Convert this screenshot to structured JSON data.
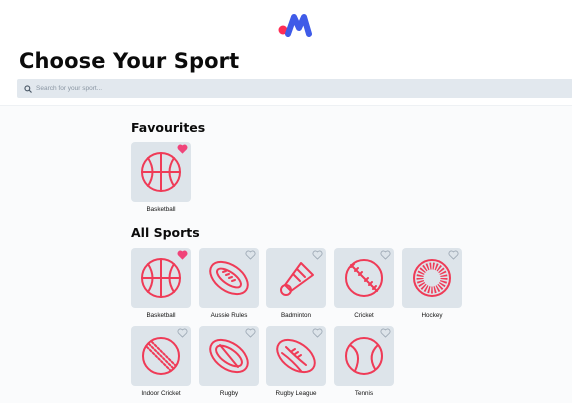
{
  "header": {
    "title": "Choose Your Sport",
    "brand_colors": {
      "dot": "#ff2d55",
      "mark": "#3f5be8"
    }
  },
  "search": {
    "placeholder": "Search for your sport..."
  },
  "sections": {
    "favourites_title": "Favourites",
    "all_title": "All Sports"
  },
  "favourites": [
    {
      "label": "Basketball",
      "icon": "basketball-icon",
      "favourited": true
    }
  ],
  "sports": [
    {
      "label": "Basketball",
      "icon": "basketball-icon",
      "favourited": true
    },
    {
      "label": "Aussie Rules",
      "icon": "aussie-rules-ball-icon",
      "favourited": false
    },
    {
      "label": "Badminton",
      "icon": "shuttlecock-icon",
      "favourited": false
    },
    {
      "label": "Cricket",
      "icon": "cricket-ball-icon",
      "favourited": false
    },
    {
      "label": "Hockey",
      "icon": "hockey-ball-icon",
      "favourited": false
    },
    {
      "label": "Indoor Cricket",
      "icon": "indoor-cricket-ball-icon",
      "favourited": false
    },
    {
      "label": "Rugby",
      "icon": "rugby-ball-icon",
      "favourited": false
    },
    {
      "label": "Rugby League",
      "icon": "rugby-league-ball-icon",
      "favourited": false
    },
    {
      "label": "Tennis",
      "icon": "tennis-ball-icon",
      "favourited": false
    }
  ],
  "colors": {
    "icon_stroke": "#ef3b57",
    "tile_bg": "#dde4ea",
    "heart_filled": "#f0447a",
    "heart_outline": "#9aa6b2"
  }
}
